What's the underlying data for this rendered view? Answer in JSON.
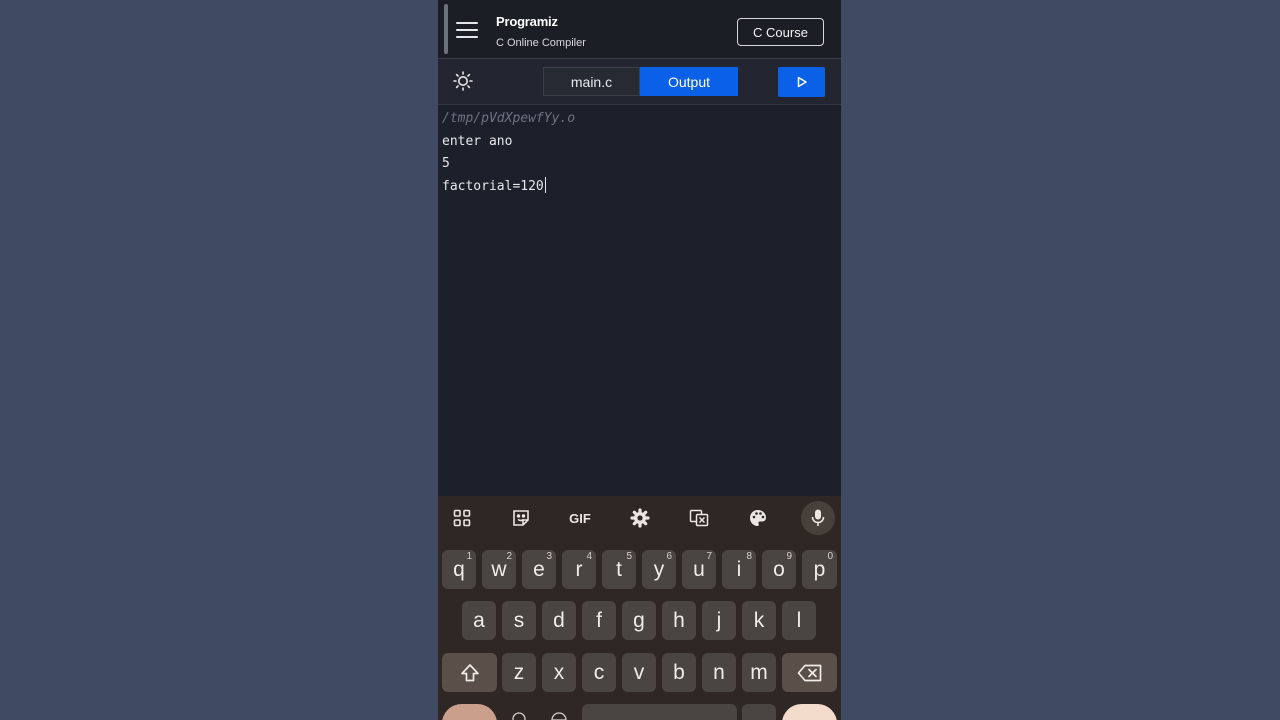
{
  "header": {
    "logo_text": "Programiz",
    "subtitle": "C Online Compiler",
    "course_button": "C Course"
  },
  "toolbar": {
    "tab_main": "main.c",
    "tab_output": "Output",
    "accent_color": "#0a61e8"
  },
  "output": {
    "path": "/tmp/pVdXpewfYy.o",
    "lines": [
      "enter ano",
      "5",
      "factorial=120"
    ]
  },
  "keyboard": {
    "toolbar": [
      "apps-grid-icon",
      "sticker-icon",
      "GIF",
      "gear-icon",
      "translate-icon",
      "palette-icon",
      "mic-icon"
    ],
    "gif_label": "GIF",
    "row1": [
      {
        "k": "q",
        "n": "1"
      },
      {
        "k": "w",
        "n": "2"
      },
      {
        "k": "e",
        "n": "3"
      },
      {
        "k": "r",
        "n": "4"
      },
      {
        "k": "t",
        "n": "5"
      },
      {
        "k": "y",
        "n": "6"
      },
      {
        "k": "u",
        "n": "7"
      },
      {
        "k": "i",
        "n": "8"
      },
      {
        "k": "o",
        "n": "9"
      },
      {
        "k": "p",
        "n": "0"
      }
    ],
    "row2": [
      "a",
      "s",
      "d",
      "f",
      "g",
      "h",
      "j",
      "k",
      "l"
    ],
    "row3": [
      "z",
      "x",
      "c",
      "v",
      "b",
      "n",
      "m"
    ]
  }
}
